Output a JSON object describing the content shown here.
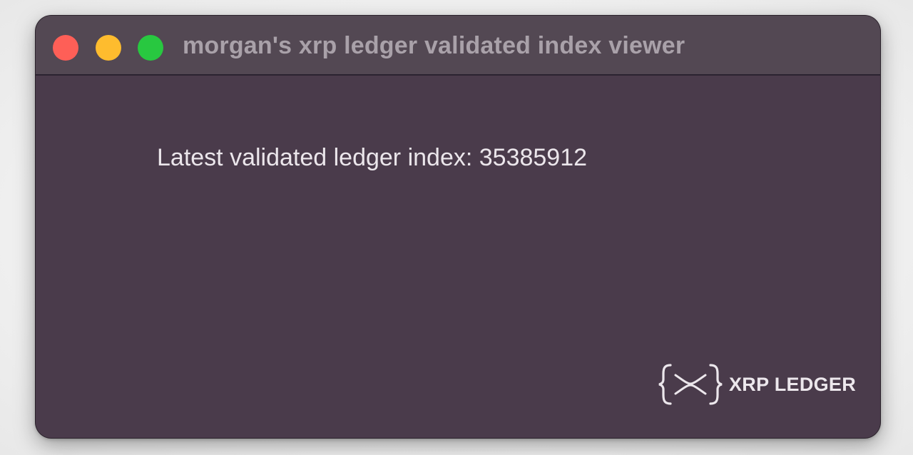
{
  "window": {
    "title": "morgan's xrp ledger validated index viewer",
    "controls": {
      "close": {
        "icon": "close-window-icon",
        "color": "#fe5f57"
      },
      "minimize": {
        "icon": "minimize-window-icon",
        "color": "#febc2e"
      },
      "maximize": {
        "icon": "maximize-window-icon",
        "color": "#28c840"
      }
    }
  },
  "main": {
    "ledger_label": "Latest validated ledger index:",
    "ledger_index": "35385912"
  },
  "branding": {
    "logo_text": "XRP LEDGER",
    "logo_icon": "xrp-ledger-logo-icon"
  },
  "colors": {
    "window_background": "#4a3b4b",
    "titlebar_background": "#534853",
    "text_primary": "#ebe6eb",
    "title_text": "#a9a1a9"
  }
}
